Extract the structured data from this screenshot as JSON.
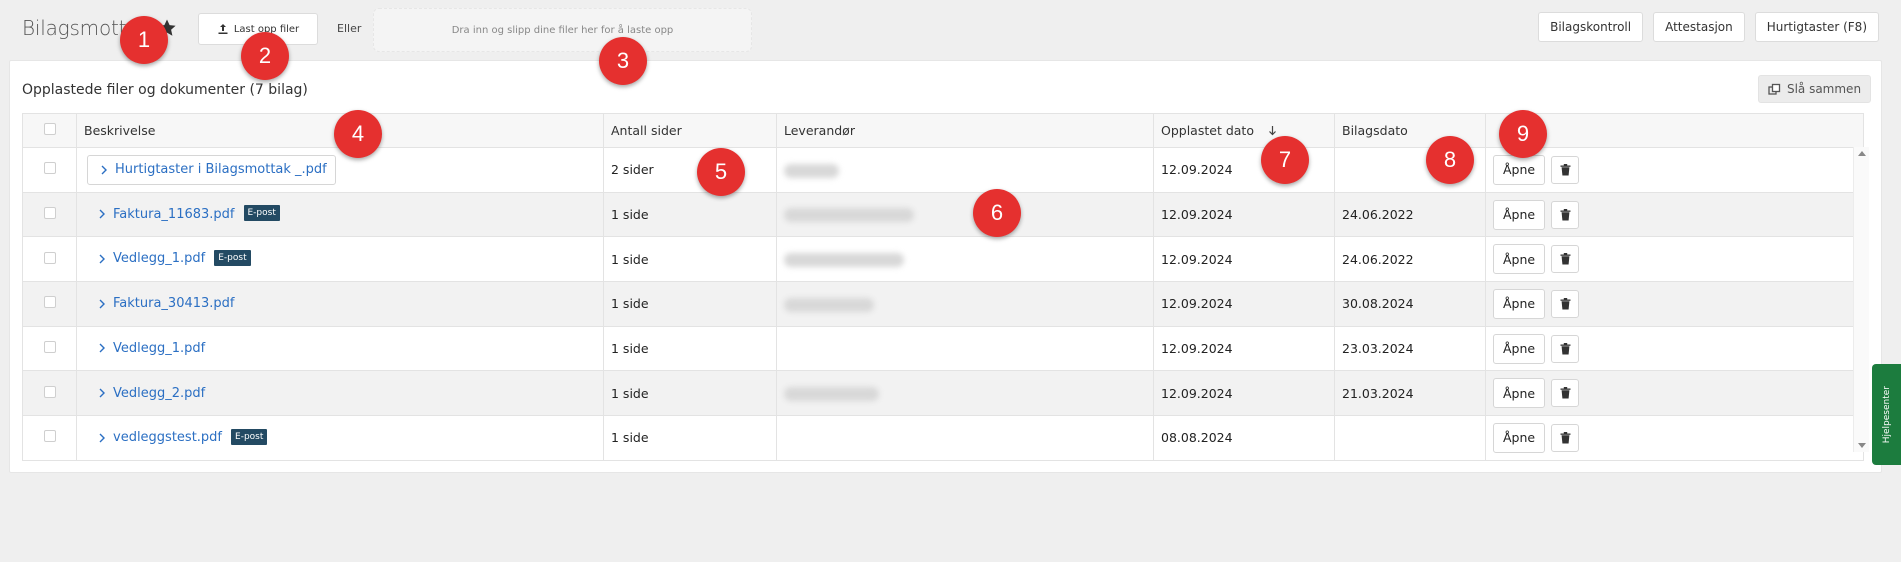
{
  "header": {
    "title": "Bilagsmottak",
    "upload_label": "Last opp filer",
    "or_label": "Eller",
    "dropzone_text": "Dra inn og slipp dine filer her for å laste opp",
    "actions": [
      "Bilagskontroll",
      "Attestasjon",
      "Hurtigtaster (F8)"
    ]
  },
  "panel": {
    "title": "Opplastede filer og dokumenter (7 bilag)",
    "merge_label": "Slå sammen"
  },
  "table": {
    "columns": [
      "Beskrivelse",
      "Antall sider",
      "Leverandør",
      "Opplastet dato",
      "Bilagsdato"
    ],
    "open_label": "Åpne",
    "badge_label": "E-post",
    "rows": [
      {
        "name": "Hurtigtaster i Bilagsmottak _.pdf",
        "pages": "2 sider",
        "uploaded": "12.09.2024",
        "date": ""
      },
      {
        "name": "Faktura_11683.pdf",
        "pages": "1 side",
        "uploaded": "12.09.2024",
        "date": "24.06.2022"
      },
      {
        "name": "Vedlegg_1.pdf",
        "pages": "1 side",
        "uploaded": "12.09.2024",
        "date": "24.06.2022"
      },
      {
        "name": "Faktura_30413.pdf",
        "pages": "1 side",
        "uploaded": "12.09.2024",
        "date": "30.08.2024"
      },
      {
        "name": "Vedlegg_1.pdf",
        "pages": "1 side",
        "uploaded": "12.09.2024",
        "date": "23.03.2024"
      },
      {
        "name": "Vedlegg_2.pdf",
        "pages": "1 side",
        "uploaded": "12.09.2024",
        "date": "21.03.2024"
      },
      {
        "name": "vedleggstest.pdf",
        "pages": "1 side",
        "uploaded": "08.08.2024",
        "date": ""
      }
    ]
  },
  "help_tab": "Hjelpesenter",
  "markers": [
    "1",
    "2",
    "3",
    "4",
    "5",
    "6",
    "7",
    "8",
    "9"
  ],
  "colors": {
    "marker": "#e5302f",
    "link": "#2b6fc3",
    "badge": "#234a63",
    "help": "#1c7c3e"
  },
  "icons": [
    "star-icon",
    "upload-icon",
    "merge-icon",
    "chevron-right-icon",
    "sort-down-icon",
    "trash-icon"
  ]
}
